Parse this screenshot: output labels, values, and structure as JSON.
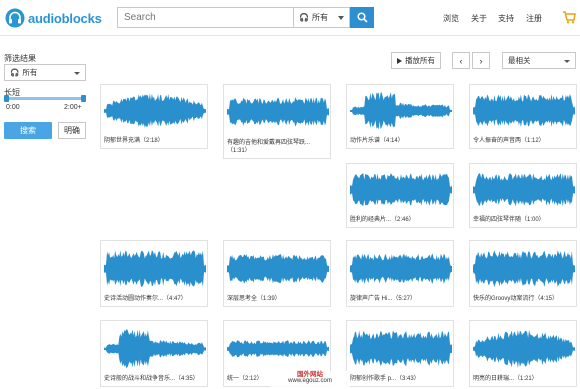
{
  "brand": {
    "name": "audioblocks"
  },
  "search": {
    "placeholder": "Search",
    "scope": "所有"
  },
  "nav": [
    {
      "label": "浏览"
    },
    {
      "label": "关于"
    },
    {
      "label": "支持"
    },
    {
      "label": "注册"
    }
  ],
  "sidebar": {
    "title": "筛选结果",
    "filter": "所有",
    "length_label": "长短",
    "min": "0:00",
    "max": "2:00+",
    "search_button": "搜索",
    "clear_button": "明确"
  },
  "toolbar": {
    "play_all": "播放所有",
    "prev": "‹",
    "next": "›",
    "sort": "最相关"
  },
  "results": [
    {
      "title": "阴郁世界充满（2:18）",
      "color": "#2a8fcd"
    },
    {
      "title": "有趣的吉他和爱戴再四弦琴跃...（1:31）",
      "color": "#2a8fcd"
    },
    {
      "title": "动作片乐谱（4:14）",
      "color": "#2a8fcd"
    },
    {
      "title": "令人振奋的声音两（1:12）",
      "color": "#2a8fcd"
    },
    {
      "title": "胜利的经典片...（2:46）",
      "color": "#2a8fcd"
    },
    {
      "title": "幸福的四弦琴伴随（1:00）",
      "color": "#2a8fcd"
    },
    {
      "title": "史诗活动圆动作奏尔...（4:47）",
      "color": "#2a8fcd"
    },
    {
      "title": "深层思考全（1:39）",
      "color": "#2a8fcd"
    },
    {
      "title": "旋律声广告 Hi...（5:27）",
      "color": "#2a8fcd"
    },
    {
      "title": "快乐的Groovy动案流行（4:15）",
      "color": "#2a8fcd"
    },
    {
      "title": "史诗般的战斗和战争音乐...（4:35）",
      "color": "#2a8fcd"
    },
    {
      "title": "统一（2:12）",
      "color": "#2a8fcd"
    },
    {
      "title": "阴郁创作歌手 p...（3:43）",
      "color": "#2a8fcd"
    },
    {
      "title": "明亮的日耕瑞...（1:21）",
      "color": "#2a8fcd"
    }
  ],
  "watermark": {
    "title": "国外网站",
    "url": "www.egouz.com"
  }
}
